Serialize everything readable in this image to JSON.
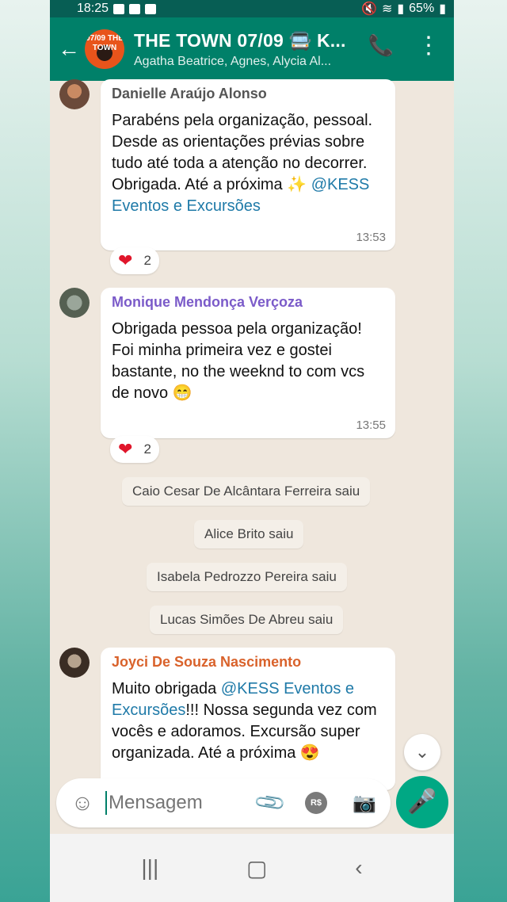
{
  "status_bar": {
    "time": "18:25",
    "battery": "65%"
  },
  "header": {
    "title": "THE TOWN 07/09 🚍 K...",
    "members": "Agatha Beatrice, Agnes, Alycia Al...",
    "avatar_text": "07/09 THE TOWN"
  },
  "messages": [
    {
      "sender": "Danielle Araújo Alonso",
      "sender_color": "#555555",
      "text": "Parabéns pela organização, pessoal. Desde as orientações prévias sobre tudo até toda a atenção no decorrer. Obrigada. Até a próxima ✨ ",
      "mention": "@KESS Eventos e Excursões",
      "time": "13:53",
      "reaction_count": "2"
    },
    {
      "sender": "Monique Mendonça Verçoza",
      "sender_color": "#7b5bc9",
      "text": "Obrigada pessoa pela organização! Foi minha primeira vez e gostei bastante, no the weeknd to com vcs de novo 😁",
      "time": "13:55",
      "reaction_count": "2"
    },
    {
      "sender": "Joyci De Souza Nascimento",
      "sender_color": "#d9622b",
      "text_before": "Muito obrigada ",
      "mention": "@KESS Eventos e Excursões",
      "text_after": "!!! Nossa segunda vez com vocês e adoramos. Excursão super organizada. Até a próxima 😍"
    }
  ],
  "system_messages": [
    "Caio Cesar De Alcântara Ferreira saiu",
    "Alice Brito saiu",
    "Isabela Pedrozzo Pereira saiu",
    "Lucas Simões De Abreu saiu"
  ],
  "composer": {
    "placeholder": "Mensagem",
    "pay_label": "R$"
  },
  "icons": {
    "back": "arrow-left-icon",
    "call": "add-call-icon",
    "more": "more-vert-icon",
    "emoji": "emoji-icon",
    "attach": "paperclip-icon",
    "camera": "camera-icon",
    "mic": "mic-icon"
  },
  "colors": {
    "header": "#008069",
    "accent": "#00a884",
    "mention": "#1f7aa8"
  }
}
